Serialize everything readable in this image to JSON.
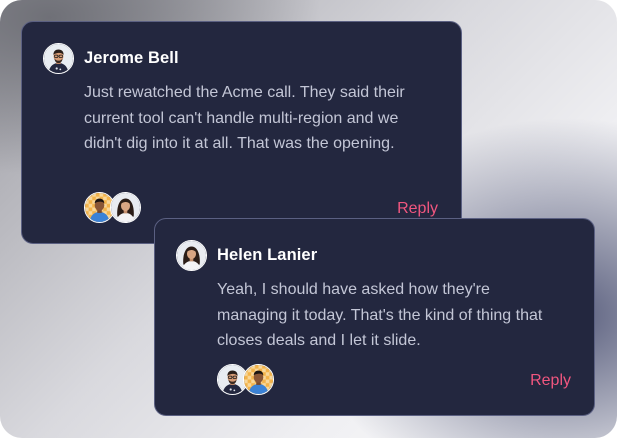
{
  "theme": {
    "card_bg": "#23273f",
    "card_border": "#5b6082",
    "name_color": "#ffffff",
    "text_color": "#c3c6d6",
    "reply_color": "#f0567f"
  },
  "comments": [
    {
      "author": "Jerome Bell",
      "avatar_icon": "man-avatar-icon",
      "text": "Just rewatched the Acme call. They said their current tool can't handle multi-region and we didn't dig into it at all. That was the opening.",
      "participants": [
        "man-on-checkered-avatar-icon",
        "woman-avatar-icon"
      ],
      "reply_label": "Reply"
    },
    {
      "author": "Helen Lanier",
      "avatar_icon": "woman-avatar-icon",
      "text": "Yeah, I should have asked how they're managing it today. That's the kind of thing that closes deals and I let it slide.",
      "participants": [
        "man-avatar-icon",
        "man-on-checkered-avatar-icon"
      ],
      "reply_label": "Reply"
    }
  ]
}
